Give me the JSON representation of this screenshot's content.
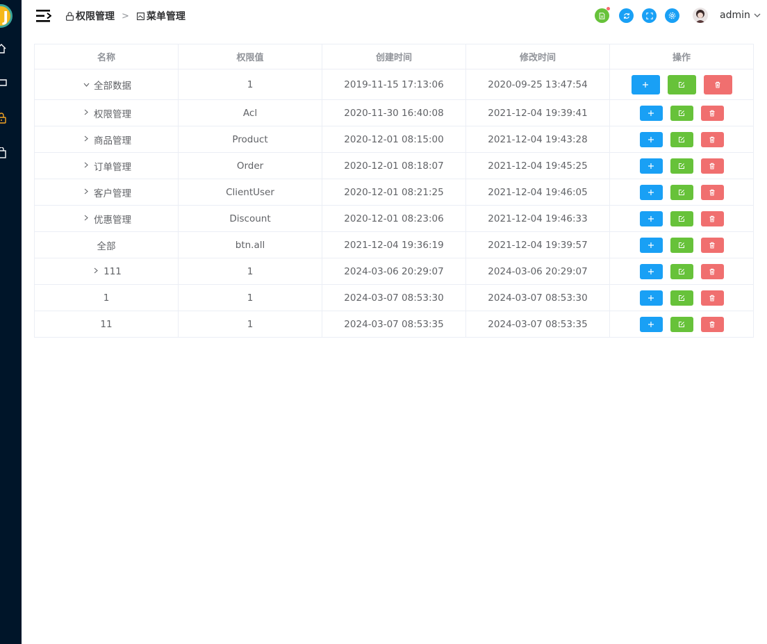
{
  "header": {
    "breadcrumbs": [
      {
        "label": "权限管理"
      },
      {
        "label": "菜单管理"
      }
    ],
    "user": {
      "name": "admin"
    }
  },
  "table": {
    "columns": [
      "名称",
      "权限值",
      "创建时间",
      "修改时间",
      "操作"
    ],
    "rows": [
      {
        "name": "全部数据",
        "code": "1",
        "created": "2019-11-15 17:13:06",
        "modified": "2020-09-25 13:47:54",
        "expand": "open",
        "indent": 0
      },
      {
        "name": "权限管理",
        "code": "Acl",
        "created": "2020-11-30 16:40:08",
        "modified": "2021-12-04 19:39:41",
        "expand": "closed",
        "indent": 1
      },
      {
        "name": "商品管理",
        "code": "Product",
        "created": "2020-12-01 08:15:00",
        "modified": "2021-12-04 19:43:28",
        "expand": "closed",
        "indent": 1
      },
      {
        "name": "订单管理",
        "code": "Order",
        "created": "2020-12-01 08:18:07",
        "modified": "2021-12-04 19:45:25",
        "expand": "closed",
        "indent": 1
      },
      {
        "name": "客户管理",
        "code": "ClientUser",
        "created": "2020-12-01 08:21:25",
        "modified": "2021-12-04 19:46:05",
        "expand": "closed",
        "indent": 1
      },
      {
        "name": "优惠管理",
        "code": "Discount",
        "created": "2020-12-01 08:23:06",
        "modified": "2021-12-04 19:46:33",
        "expand": "closed",
        "indent": 1
      },
      {
        "name": "全部",
        "code": "btn.all",
        "created": "2021-12-04 19:36:19",
        "modified": "2021-12-04 19:39:57",
        "expand": "none",
        "indent": 1
      },
      {
        "name": "111",
        "code": "1",
        "created": "2024-03-06 20:29:07",
        "modified": "2024-03-06 20:29:07",
        "expand": "closed",
        "indent": 1
      },
      {
        "name": "1",
        "code": "1",
        "created": "2024-03-07 08:53:30",
        "modified": "2024-03-07 08:53:30",
        "expand": "none",
        "indent": 1
      },
      {
        "name": "11",
        "code": "1",
        "created": "2024-03-07 08:53:35",
        "modified": "2024-03-07 08:53:35",
        "expand": "none",
        "indent": 1
      }
    ]
  },
  "colors": {
    "sidebar": "#001529",
    "primary": "#19a0f5",
    "success": "#67c23a",
    "danger": "#f06f6f"
  }
}
